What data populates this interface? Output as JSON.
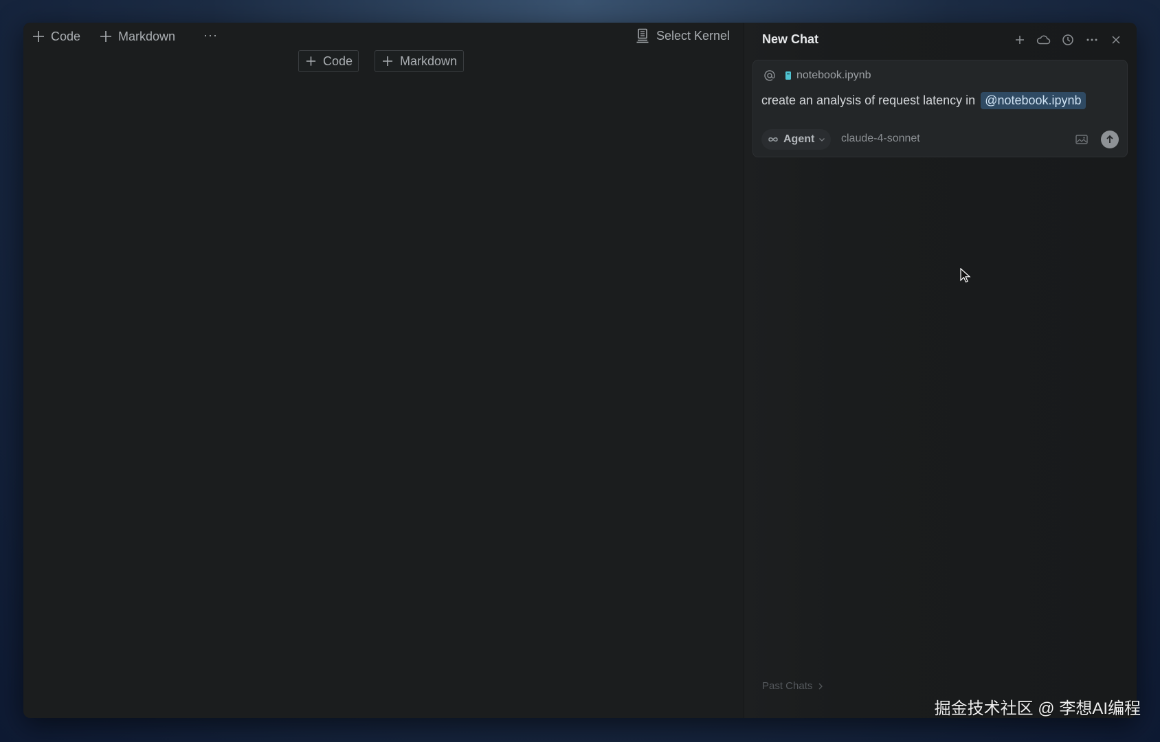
{
  "notebook": {
    "toolbar": {
      "add_code_label": "Code",
      "add_markdown_label": "Markdown",
      "more_label": "···",
      "kernel_label": "Select Kernel"
    },
    "insert": {
      "code_label": "Code",
      "markdown_label": "Markdown"
    }
  },
  "chat": {
    "title": "New Chat",
    "header_icons": [
      "plus-icon",
      "cloud-icon",
      "history-icon",
      "more-icon",
      "close-icon"
    ],
    "composer": {
      "context_file": "notebook.ipynb",
      "prompt_text": "create an analysis of request latency in",
      "mention": "@notebook.ipynb",
      "mode_label": "Agent",
      "model_label": "claude-4-sonnet"
    },
    "past_chats_label": "Past Chats"
  },
  "watermark": "掘金技术社区 @ 李想AI编程",
  "colors": {
    "background": "#1b1d1e",
    "mention_bg": "#2f4a63",
    "file_icon": "#4fc3d1"
  }
}
